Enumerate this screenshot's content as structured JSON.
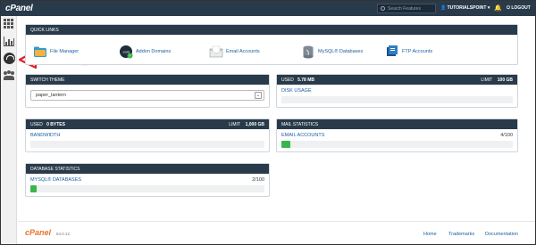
{
  "topbar": {
    "logo": "cPanel",
    "search_placeholder": "Search Features",
    "user": "TUTORIALSPOINT",
    "logout": "LOGOUT"
  },
  "quick_links": {
    "title": "QUICK LINKS",
    "items": [
      {
        "label": "File Manager",
        "icon": "file-manager-icon"
      },
      {
        "label": "Addon Domains",
        "icon": "addon-domains-icon"
      },
      {
        "label": "Email Accounts",
        "icon": "email-icon"
      },
      {
        "label": "MySQL® Databases",
        "icon": "mysql-icon"
      },
      {
        "label": "FTP Accounts",
        "icon": "ftp-icon"
      }
    ]
  },
  "switch_theme": {
    "title": "SWITCH THEME",
    "selected": "paper_lantern"
  },
  "disk": {
    "used_label": "USED",
    "used_value": "5.78 MB",
    "limit_label": "LIMIT",
    "limit_value": "100 GB",
    "stat_label": "DISK USAGE",
    "fraction": 0.0
  },
  "bandwidth": {
    "used_label": "USED",
    "used_value": "0 BYTES",
    "limit_label": "LIMIT",
    "limit_value": "1,000 GB",
    "stat_label": "BANDWIDTH",
    "fraction": 0.0
  },
  "mail": {
    "title": "MAIL STATISTICS",
    "stat_label": "EMAIL ACCOUNTS",
    "value": "4/100",
    "fraction": 0.04
  },
  "database": {
    "title": "DATABASE STATISTICS",
    "stat_label": "MYSQL® DATABASES",
    "value": "2/100",
    "fraction": 0.02
  },
  "footer": {
    "logo": "cPanel",
    "version": "54.0.12",
    "links": [
      "Home",
      "Trademarks",
      "Documentation"
    ]
  },
  "colors": {
    "topbar": "#293a4a",
    "link": "#1a5ea6",
    "progress": "#3ab54a",
    "arrow": "#e0212a"
  }
}
